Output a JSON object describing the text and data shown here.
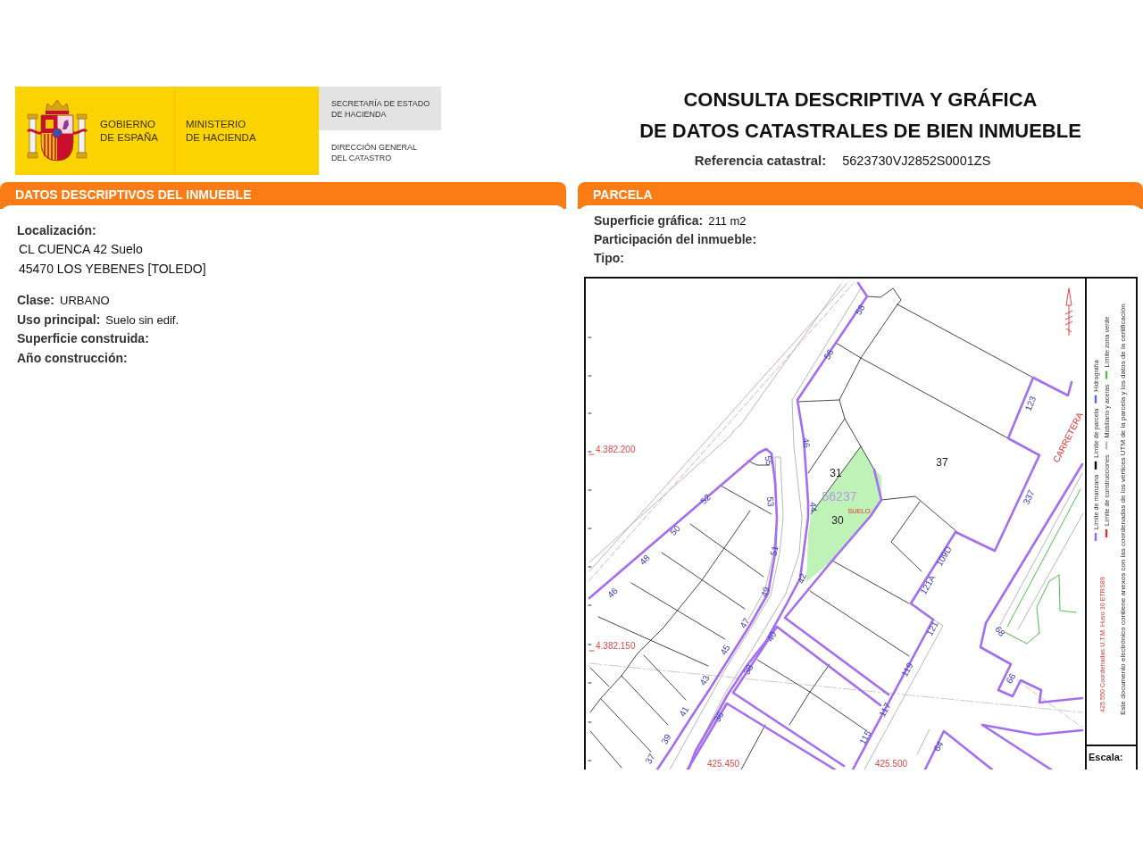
{
  "header": {
    "government": [
      "GOBIERNO",
      "DE ESPAÑA"
    ],
    "ministry": [
      "MINISTERIO",
      "DE HACIENDA"
    ],
    "secretariat": [
      "SECRETARÍA DE ESTADO",
      "DE HACIENDA"
    ],
    "directorate": [
      "DIRECCIÓN GENERAL",
      "DEL CATASTRO"
    ]
  },
  "title": [
    "CONSULTA DESCRIPTIVA Y GRÁFICA",
    "DE DATOS CATASTRALES DE BIEN INMUEBLE"
  ],
  "reference": {
    "label": "Referencia catastral:",
    "value": "5623730VJ2852S0001ZS"
  },
  "descriptive_panel": {
    "title": "DATOS DESCRIPTIVOS DEL INMUEBLE",
    "location_label": "Localización:",
    "address": [
      "CL CUENCA 42 Suelo",
      "45470 LOS YEBENES [TOLEDO]"
    ],
    "fields": [
      {
        "label": "Clase:",
        "value": "URBANO"
      },
      {
        "label": "Uso principal:",
        "value": "Suelo sin edif."
      },
      {
        "label": "Superficie construida:"
      },
      {
        "label": "Año construcción:"
      }
    ]
  },
  "parcel_panel": {
    "title": "PARCELA",
    "fields": [
      {
        "label": "Superficie gráfica:",
        "value": "211 m2"
      },
      {
        "label": "Participación del inmueble:"
      },
      {
        "label": "Tipo:"
      }
    ],
    "map": {
      "labels": [
        {
          "kind": "street_number",
          "text": "58"
        },
        {
          "kind": "street_number",
          "text": "56"
        },
        {
          "kind": "street_number",
          "text": "123"
        },
        {
          "kind": "road_name",
          "text": "CARRETERA"
        },
        {
          "kind": "street_number",
          "text": "46"
        },
        {
          "kind": "coordinate",
          "text": "4.382.200"
        },
        {
          "kind": "street_number",
          "text": "55"
        },
        {
          "kind": "parcel_number",
          "text": "37"
        },
        {
          "kind": "parcel_number",
          "text": "31"
        },
        {
          "kind": "street_number",
          "text": "337"
        },
        {
          "kind": "parcel_reference",
          "text": "56237"
        },
        {
          "kind": "street_number",
          "text": "52"
        },
        {
          "kind": "street_number",
          "text": "53"
        },
        {
          "kind": "street_number",
          "text": "44"
        },
        {
          "kind": "land_use",
          "text": "SUELO"
        },
        {
          "kind": "parcel_number",
          "text": "30"
        },
        {
          "kind": "street_number",
          "text": "50"
        },
        {
          "kind": "street_number",
          "text": "51"
        },
        {
          "kind": "street_number",
          "text": "109D"
        },
        {
          "kind": "street_number",
          "text": "48"
        },
        {
          "kind": "street_number",
          "text": "42"
        },
        {
          "kind": "street_number",
          "text": "121A"
        },
        {
          "kind": "street_number",
          "text": "49"
        },
        {
          "kind": "street_number",
          "text": "46"
        },
        {
          "kind": "street_number",
          "text": "47"
        },
        {
          "kind": "street_number",
          "text": "121"
        },
        {
          "kind": "street_number",
          "text": "68"
        },
        {
          "kind": "street_number",
          "text": "40"
        },
        {
          "kind": "coordinate",
          "text": "4.382.150"
        },
        {
          "kind": "street_number",
          "text": "45"
        },
        {
          "kind": "street_number",
          "text": "38"
        },
        {
          "kind": "street_number",
          "text": "119"
        },
        {
          "kind": "street_number",
          "text": "66"
        },
        {
          "kind": "street_number",
          "text": "43"
        },
        {
          "kind": "street_number",
          "text": "117"
        },
        {
          "kind": "street_number",
          "text": "41"
        },
        {
          "kind": "street_number",
          "text": "36"
        },
        {
          "kind": "street_number",
          "text": "115"
        },
        {
          "kind": "street_number",
          "text": "39"
        },
        {
          "kind": "street_number",
          "text": "64"
        },
        {
          "kind": "street_number",
          "text": "37"
        },
        {
          "kind": "coordinate",
          "text": "425.450"
        },
        {
          "kind": "coordinate",
          "text": "425.500"
        }
      ],
      "legend": {
        "items": [
          {
            "label": "Límite de manzana",
            "color": "#9966ee"
          },
          {
            "label": "Límite de parcela",
            "color": "#000000"
          },
          {
            "label": "Hidrografía",
            "color": "#5566ee"
          },
          {
            "label": "Límite de construcciones",
            "color": "#cc3333"
          },
          {
            "label": "Mobiliario y aceras",
            "color": "#bbbbbb"
          },
          {
            "label": "Límite zona verde",
            "color": "#55bb55"
          }
        ],
        "coordinate_note": "425.550 Coordenadas U.T.M. Huso 30 ETRS89",
        "notice": "Este documento electrónico contiene anexos con las coordenadas de los vértices UTM de la parcela y los datos de la certificación",
        "scale_label": "Escala:"
      }
    }
  }
}
